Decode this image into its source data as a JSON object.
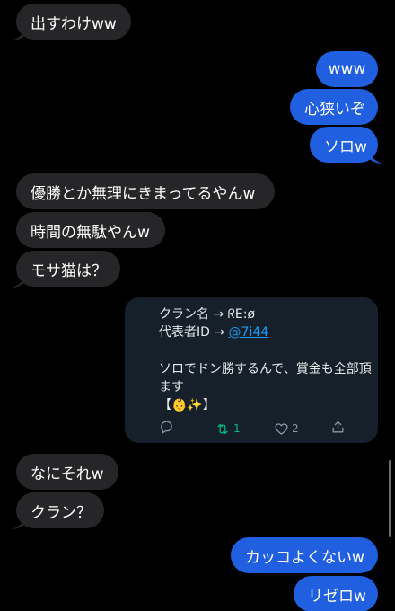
{
  "messages": [
    {
      "side": "received",
      "text": "出すわけww"
    },
    {
      "side": "sent",
      "text": "www"
    },
    {
      "side": "sent",
      "text": "心狭いぞ"
    },
    {
      "side": "sent",
      "text": "ソロw"
    },
    {
      "side": "received",
      "text": "優勝とか無理にきまってるやんw"
    },
    {
      "side": "received",
      "text": "時間の無駄やんw"
    },
    {
      "side": "received",
      "text": "モサ猫は？"
    },
    {
      "side": "received",
      "text": "なにそれw"
    },
    {
      "side": "received",
      "text": "クラン？"
    },
    {
      "side": "sent",
      "text": "カッコよくないw"
    },
    {
      "side": "sent",
      "text": "リゼロw"
    }
  ],
  "tweet_card": {
    "line1": "クラン名 → ᖇE:ø",
    "line2_prefix": "代表者ID → ",
    "line2_link": "@7i44",
    "line3": "ソロでドン勝するんで、賞金も全部頂",
    "line4": "ます",
    "line5_open": "【",
    "line5_emoji": "👶✨",
    "line5_close": "】",
    "retweets": "1",
    "likes": "2"
  },
  "icons": {
    "reply": "reply-icon",
    "retweet": "retweet-icon",
    "like": "heart-icon",
    "share": "share-icon"
  },
  "colors": {
    "background": "#000000",
    "received_bubble": "#262628",
    "sent_bubble": "#1f5fe0",
    "card_background": "#15202b",
    "link": "#1d9bf0",
    "retweet": "#00ba7c"
  }
}
